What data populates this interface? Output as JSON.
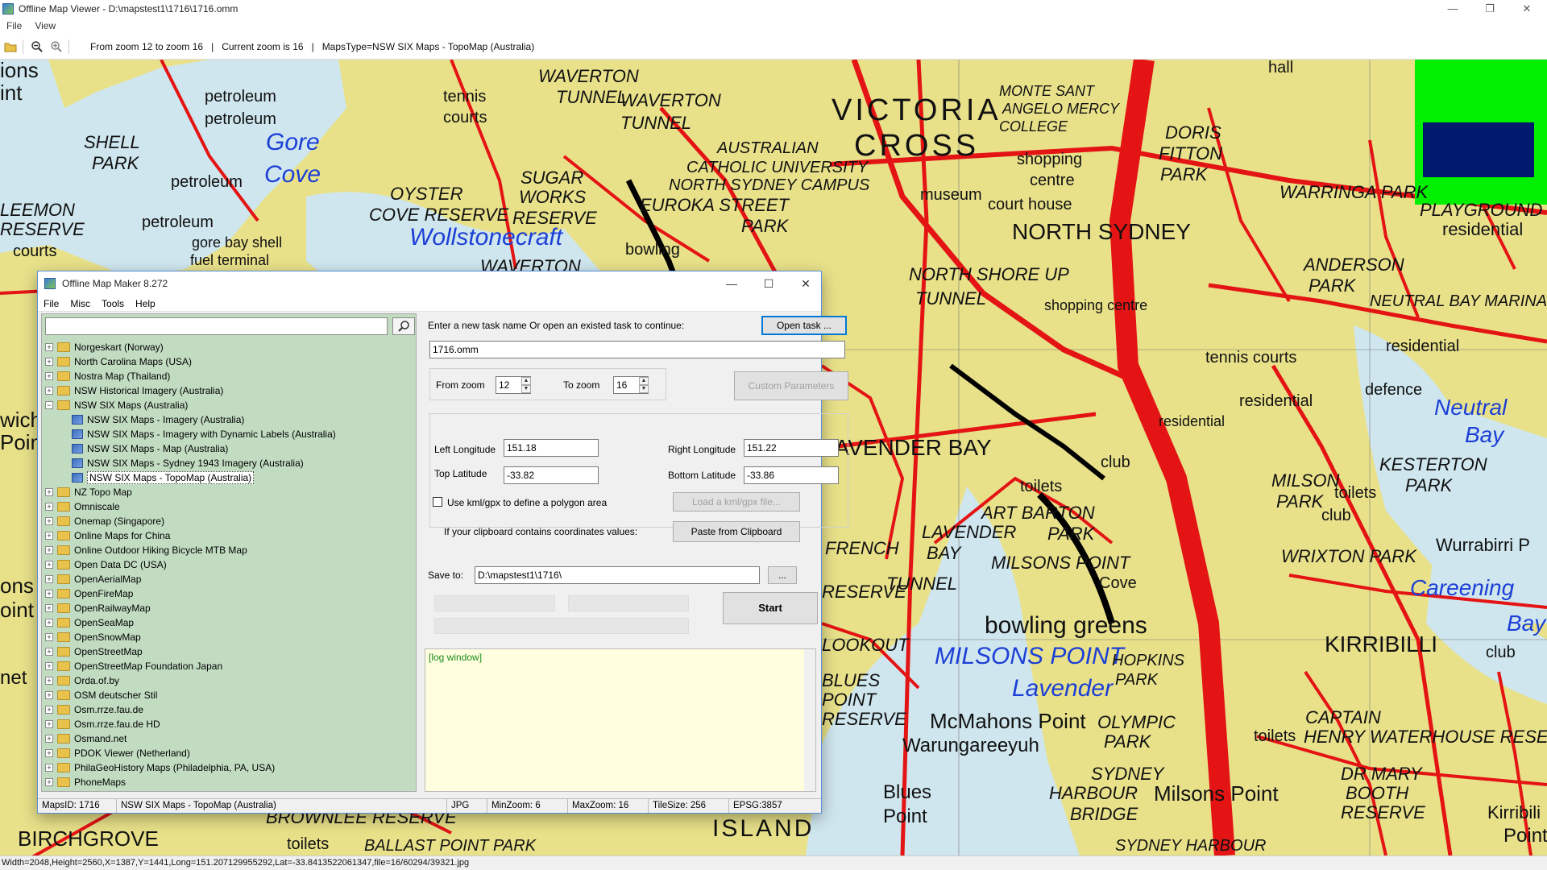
{
  "window": {
    "title": "Offline Map Viewer - D:\\mapstest1\\1716\\1716.omm",
    "menu": [
      "File",
      "View"
    ],
    "controls": [
      "—",
      "❐",
      "✕"
    ]
  },
  "toolbar": {
    "zoom_range": "From zoom 12 to zoom 16",
    "current_zoom": "Current zoom is 16",
    "maps_type": "MapsType=NSW SIX Maps - TopoMap (Australia)",
    "separator": "|"
  },
  "map": {
    "labels": [
      "ions",
      "int",
      "SHELL",
      "PARK",
      "LEEMON",
      "RESERVE",
      "courts",
      "petroleum",
      "petroleum",
      "petroleum",
      "petroleum",
      "Gore",
      "Cove",
      "gore bay shell",
      "fuel terminal",
      "tennis",
      "courts",
      "WAVERTON",
      "TUNNEL",
      "WAVERTON",
      "TUNNEL",
      "SUGAR",
      "WORKS",
      "RESERVE",
      "OYSTER",
      "COVE RESERVE",
      "Wollstonecraft",
      "WAVERTON",
      "bowling",
      "VICTORIA",
      "CROSS",
      "AUSTRALIAN",
      "CATHOLIC UNIVERSITY",
      "NORTH SYDNEY CAMPUS",
      "EUROKA STREET",
      "PARK",
      "MONTE SANT",
      "ANGELO MERCY",
      "COLLEGE",
      "shopping",
      "centre",
      "court house",
      "museum",
      "NORTH SYDNEY",
      "DORIS",
      "FITTON",
      "PARK",
      "WARRINGA PARK",
      "PLAYGROUND",
      "residential",
      "hall",
      "NORTH SHORE UP",
      "TUNNEL",
      "shopping centre",
      "ANDERSON",
      "PARK",
      "NEUTRAL BAY MARINA",
      "residential",
      "tennis courts",
      "defence",
      "Neutral",
      "Bay",
      "KESTERTON",
      "PARK",
      "residential",
      "residential",
      "LAVENDER BAY",
      "club",
      "toilets",
      "MILSON",
      "PARK",
      "toilets",
      "club",
      "Wurrabirri P",
      "ART BARTON",
      "PARK",
      "LAVENDER",
      "BAY",
      "MILSONS POINT",
      "WRIXTON PARK",
      "Careening",
      "Cove",
      "bowling greens",
      "MILSONS POINT",
      "Lavender",
      "Bay",
      "KIRRIBILLI",
      "club",
      "FRENCH",
      "RESERVE",
      "TUNNEL",
      "LOOKOUT",
      "BLUES",
      "POINT",
      "RESERVE",
      "HOPKINS",
      "PARK",
      "McMahons Point",
      "Warungareeyuh",
      "OLYMPIC",
      "PARK",
      "toilets",
      "CAPTAIN",
      "HENRY WATERHOUSE RESER",
      "SYDNEY",
      "HARBOUR",
      "BRIDGE",
      "Blues",
      "Point",
      "Milsons Point",
      "DR MARY",
      "BOOTH",
      "RESERVE",
      "Kirribili",
      "Point",
      "BROWNLEE RESERVE",
      "BIRCHGROVE",
      "ISLAND",
      "toilets",
      "BALLAST POINT PARK",
      "SYDNEY HARBOUR",
      "ons",
      "oint",
      "wich",
      "Point",
      "net"
    ]
  },
  "status": {
    "text": "Width=2048,Height=2560,X=1387,Y=1441,Long=151.207129955292,Lat=-33.8413522061347,file=16/60294/39321.jpg"
  },
  "dialog": {
    "title": "Offline Map Maker 8.272",
    "menu": [
      "File",
      "Misc",
      "Tools",
      "Help"
    ],
    "controls": [
      "—",
      "☐",
      "✕"
    ],
    "search": {
      "value": "",
      "placeholder": ""
    },
    "tree": [
      {
        "label": "Norgeskart (Norway)",
        "level": 0,
        "expanded": false
      },
      {
        "label": "North Carolina Maps (USA)",
        "level": 0,
        "expanded": false
      },
      {
        "label": "Nostra Map (Thailand)",
        "level": 0,
        "expanded": false
      },
      {
        "label": "NSW Historical Imagery (Australia)",
        "level": 0,
        "expanded": false
      },
      {
        "label": "NSW SIX Maps (Australia)",
        "level": 0,
        "expanded": true
      },
      {
        "label": "NSW SIX Maps - Imagery (Australia)",
        "level": 1
      },
      {
        "label": "NSW SIX Maps - Imagery with Dynamic Labels (Australia)",
        "level": 1
      },
      {
        "label": "NSW SIX Maps - Map (Australia)",
        "level": 1
      },
      {
        "label": "NSW SIX Maps - Sydney 1943 Imagery (Australia)",
        "level": 1
      },
      {
        "label": "NSW SIX Maps - TopoMap (Australia)",
        "level": 1,
        "selected": true
      },
      {
        "label": "NZ Topo Map",
        "level": 0,
        "expanded": false
      },
      {
        "label": "Omniscale",
        "level": 0,
        "expanded": false
      },
      {
        "label": "Onemap (Singapore)",
        "level": 0,
        "expanded": false
      },
      {
        "label": "Online Maps for China",
        "level": 0,
        "expanded": false
      },
      {
        "label": "Online Outdoor Hiking Bicycle MTB Map",
        "level": 0,
        "expanded": false
      },
      {
        "label": "Open Data DC (USA)",
        "level": 0,
        "expanded": false
      },
      {
        "label": "OpenAerialMap",
        "level": 0,
        "expanded": false
      },
      {
        "label": "OpenFireMap",
        "level": 0,
        "expanded": false
      },
      {
        "label": "OpenRailwayMap",
        "level": 0,
        "expanded": false
      },
      {
        "label": "OpenSeaMap",
        "level": 0,
        "expanded": false
      },
      {
        "label": "OpenSnowMap",
        "level": 0,
        "expanded": false
      },
      {
        "label": "OpenStreetMap",
        "level": 0,
        "expanded": false
      },
      {
        "label": "OpenStreetMap Foundation Japan",
        "level": 0,
        "expanded": false
      },
      {
        "label": "Orda.of.by",
        "level": 0,
        "expanded": false
      },
      {
        "label": "OSM deutscher Stil",
        "level": 0,
        "expanded": false
      },
      {
        "label": "Osm.rrze.fau.de",
        "level": 0,
        "expanded": false
      },
      {
        "label": "Osm.rrze.fau.de HD",
        "level": 0,
        "expanded": false
      },
      {
        "label": "Osmand.net",
        "level": 0,
        "expanded": false
      },
      {
        "label": "PDOK Viewer (Netherland)",
        "level": 0,
        "expanded": false
      },
      {
        "label": "PhilaGeoHistory Maps (Philadelphia, PA, USA)",
        "level": 0,
        "expanded": false
      },
      {
        "label": "PhoneMaps",
        "level": 0,
        "expanded": false
      }
    ],
    "task_prompt": "Enter a new task name Or open an existed task to continue:",
    "open_task_label": "Open task ...",
    "task_name": "1716.omm",
    "from_zoom_label": "From zoom",
    "from_zoom_value": "12",
    "to_zoom_label": "To zoom",
    "to_zoom_value": "16",
    "custom_params_label": "Custom Parameters",
    "left_lon_label": "Left Longitude",
    "left_lon_value": "151.18",
    "right_lon_label": "Right Longitude",
    "right_lon_value": "151.22",
    "top_lat_label": "Top Latitude",
    "top_lat_value": "-33.82",
    "bottom_lat_label": "Bottom Latitude",
    "bottom_lat_value": "-33.86",
    "kml_checkbox_label": "Use kml/gpx to define a polygon area",
    "kml_checked": false,
    "load_kml_label": "Load a kml/gpx file...",
    "clipboard_prompt": "If your clipboard contains coordinates values:",
    "paste_label": "Paste from Clipboard",
    "save_to_label": "Save to:",
    "save_to_value": "D:\\mapstest1\\1716\\",
    "browse_label": "...",
    "start_label": "Start",
    "log_label": "[log window]",
    "status": {
      "maps_id": "MapsID: 1716",
      "map_name": "NSW SIX Maps - TopoMap (Australia)",
      "format": "JPG",
      "min_zoom": "MinZoom: 6",
      "max_zoom": "MaxZoom: 16",
      "tile_size": "TileSize: 256",
      "epsg": "EPSG:3857"
    }
  }
}
